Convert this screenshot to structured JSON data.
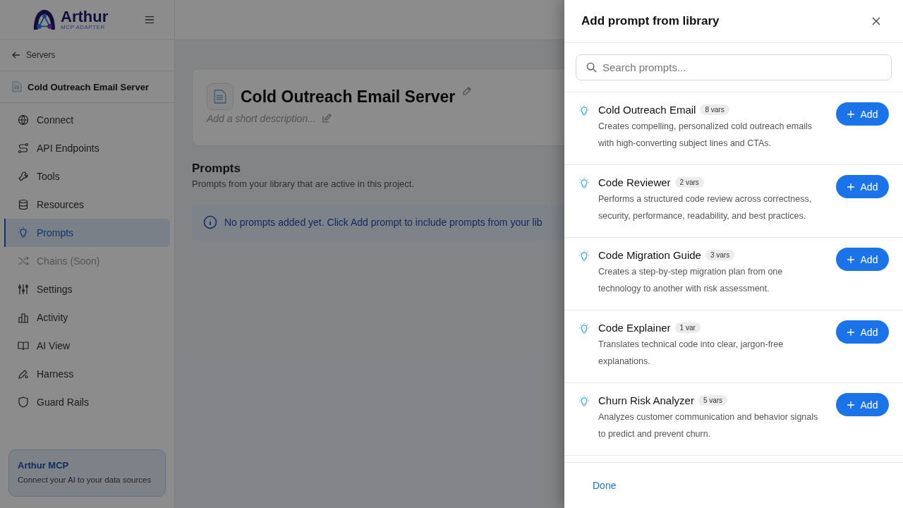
{
  "brand": {
    "name": "Arthur",
    "tagline": "MCP ADAPTER"
  },
  "back_link": "Servers",
  "server_name": "Cold Outreach Email Server",
  "nav": [
    {
      "label": "Connect",
      "selected": false,
      "disabled": false
    },
    {
      "label": "API Endpoints",
      "selected": false,
      "disabled": false
    },
    {
      "label": "Tools",
      "selected": false,
      "disabled": false
    },
    {
      "label": "Resources",
      "selected": false,
      "disabled": false
    },
    {
      "label": "Prompts",
      "selected": true,
      "disabled": false
    },
    {
      "label": "Chains (Soon)",
      "selected": false,
      "disabled": true
    },
    {
      "label": "Settings",
      "selected": false,
      "disabled": false
    },
    {
      "label": "Activity",
      "selected": false,
      "disabled": false
    },
    {
      "label": "AI View",
      "selected": false,
      "disabled": false
    },
    {
      "label": "Harness",
      "selected": false,
      "disabled": false
    },
    {
      "label": "Guard Rails",
      "selected": false,
      "disabled": false
    }
  ],
  "promo": {
    "title": "Arthur MCP",
    "text": "Connect your AI to your data sources"
  },
  "project": {
    "title": "Cold Outreach Email Server",
    "description_placeholder": "Add a short description..."
  },
  "section": {
    "title": "Prompts",
    "subtitle": "Prompts from your library that are active in this project.",
    "notice": "No prompts added yet. Click Add prompt to include prompts from your lib"
  },
  "drawer": {
    "title": "Add prompt from library",
    "search": {
      "placeholder": "Search prompts..."
    },
    "prompts": [
      {
        "name": "Cold Outreach Email",
        "vars": "8 vars",
        "description": "Creates compelling, personalized cold outreach emails with high-converting subject lines and CTAs.",
        "button": "Add"
      },
      {
        "name": "Code Reviewer",
        "vars": "2 vars",
        "description": "Performs a structured code review across correctness, security, performance, readability, and best practices.",
        "button": "Add"
      },
      {
        "name": "Code Migration Guide",
        "vars": "3 vars",
        "description": "Creates a step-by-step migration plan from one technology to another with risk assessment.",
        "button": "Add"
      },
      {
        "name": "Code Explainer",
        "vars": "1 var",
        "description": "Translates technical code into clear, jargon-free explanations.",
        "button": "Add"
      },
      {
        "name": "Churn Risk Analyzer",
        "vars": "5 vars",
        "description": "Analyzes customer communication and behavior signals to predict and prevent churn.",
        "button": "Add"
      }
    ],
    "done": "Done"
  }
}
